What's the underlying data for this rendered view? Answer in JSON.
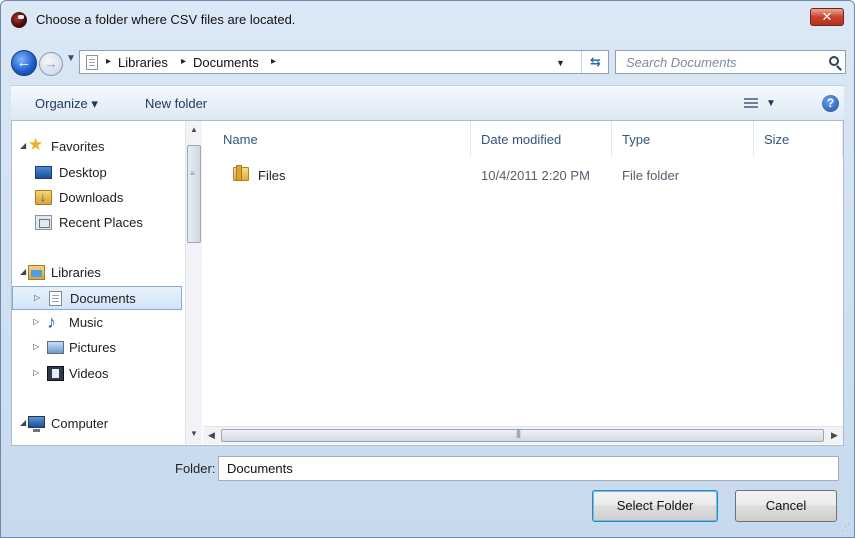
{
  "window": {
    "title": "Choose a folder where CSV files are located.",
    "close_glyph": "✕"
  },
  "address_bar": {
    "breadcrumbs": [
      "Libraries",
      "Documents"
    ],
    "separator_glyph": "▸",
    "search_placeholder": "Search Documents"
  },
  "toolbar": {
    "organize_label": "Organize ▾",
    "new_folder_label": "New folder"
  },
  "nav_pane": {
    "items": [
      {
        "label": "Favorites",
        "icon": "star-icon",
        "group": true
      },
      {
        "label": "Desktop",
        "icon": "desktop-icon"
      },
      {
        "label": "Downloads",
        "icon": "downloads-icon"
      },
      {
        "label": "Recent Places",
        "icon": "recent-places-icon"
      },
      {
        "label": "Libraries",
        "icon": "libraries-icon",
        "group": true
      },
      {
        "label": "Documents",
        "icon": "documents-icon",
        "selected": true
      },
      {
        "label": "Music",
        "icon": "music-icon"
      },
      {
        "label": "Pictures",
        "icon": "pictures-icon"
      },
      {
        "label": "Videos",
        "icon": "videos-icon"
      },
      {
        "label": "Computer",
        "icon": "computer-icon",
        "group": true
      }
    ]
  },
  "file_list": {
    "columns": [
      "Name",
      "Date modified",
      "Type",
      "Size"
    ],
    "rows": [
      {
        "name": "Files",
        "date_modified": "10/4/2011 2:20 PM",
        "type": "File folder",
        "size": ""
      }
    ]
  },
  "footer": {
    "folder_label": "Folder:",
    "folder_value": "Documents",
    "select_button": "Select Folder",
    "cancel_button": "Cancel"
  },
  "colors": {
    "chrome": "#c7d9ee",
    "selection": "#d2e5f8",
    "header_text": "#33557b"
  }
}
